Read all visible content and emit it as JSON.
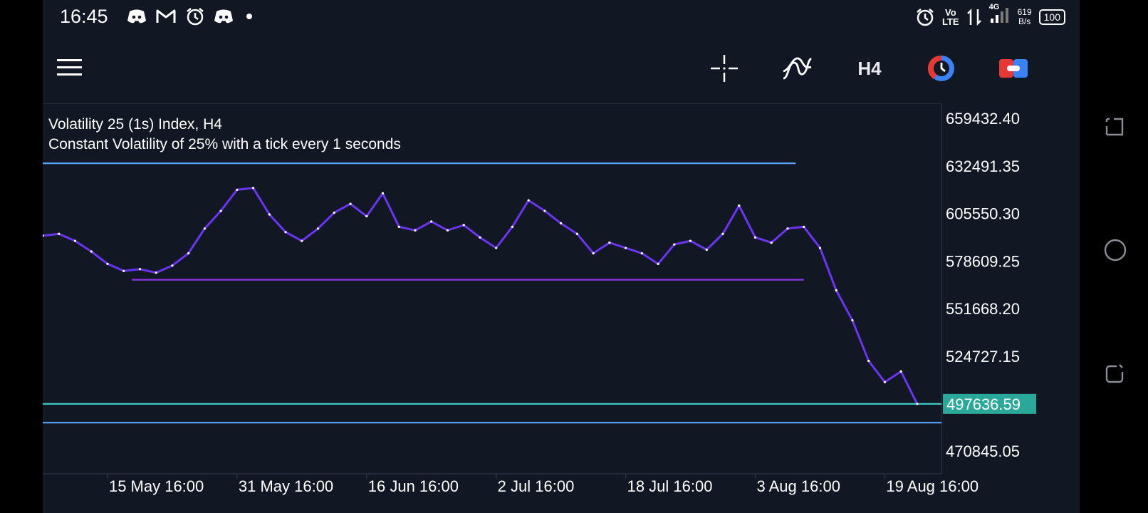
{
  "status": {
    "time": "16:45",
    "left_icons": [
      "discord-icon",
      "gmail-icon",
      "alarm-icon",
      "discord-icon",
      "notification-dot-icon"
    ],
    "right_icons": [
      "alarm-icon",
      "volte-icon",
      "data-arrows-icon",
      "signal-icon"
    ],
    "volte": "Vo\nLTE",
    "network": "4G",
    "data_rate": "619\nB/s",
    "battery": "100"
  },
  "toolbar": {
    "menu_icon": "hamburger-menu-icon",
    "crosshair_icon": "crosshair-icon",
    "indicators_icon": "indicators-icon",
    "timeframe": "H4",
    "clock_icon": "chart-clock-icon",
    "toggle_icon": "trade-toggle-icon"
  },
  "chart": {
    "title": "Volatility 25 (1s) Index, H4",
    "subtitle": "Constant Volatility of 25% with a tick every 1 seconds",
    "current_price": "497636.59"
  },
  "colors": {
    "background": "#111824",
    "price_line": "#6b34f0",
    "hline_blue": "#5aa6ff",
    "hline_purple": "#8a35e8",
    "hline_cyan": "#3fc7c0",
    "price_badge": "#2aa89a"
  },
  "chart_data": {
    "type": "line",
    "series_color": "#6b34f0",
    "x": [
      "15 May 16:00",
      "31 May 16:00",
      "16 Jun 16:00",
      "2 Jul 16:00",
      "18 Jul 16:00",
      "3 Aug 16:00",
      "19 Aug 16:00"
    ],
    "y_ticks": [
      "659432.40",
      "632491.35",
      "605550.30",
      "578609.25",
      "551668.20",
      "524727.15",
      "497636.59",
      "470845.05"
    ],
    "y_tick_values": [
      659432.4,
      632491.35,
      605550.3,
      578609.25,
      551668.2,
      524727.15,
      497636.59,
      470845.05
    ],
    "ylim": [
      458000,
      668000
    ],
    "xlim": [
      "2023-05-07",
      "2023-08-26"
    ],
    "series": [
      {
        "x": [
          "2023-05-07",
          "2023-05-09",
          "2023-05-11",
          "2023-05-13",
          "2023-05-15",
          "2023-05-17",
          "2023-05-19",
          "2023-05-21",
          "2023-05-23",
          "2023-05-25",
          "2023-05-27",
          "2023-05-29",
          "2023-05-31",
          "2023-06-02",
          "2023-06-04",
          "2023-06-06",
          "2023-06-08",
          "2023-06-10",
          "2023-06-12",
          "2023-06-14",
          "2023-06-16",
          "2023-06-18",
          "2023-06-20",
          "2023-06-22",
          "2023-06-24",
          "2023-06-26",
          "2023-06-28",
          "2023-06-30",
          "2023-07-02",
          "2023-07-04",
          "2023-07-06",
          "2023-07-08",
          "2023-07-10",
          "2023-07-12",
          "2023-07-14",
          "2023-07-16",
          "2023-07-18",
          "2023-07-20",
          "2023-07-22",
          "2023-07-24",
          "2023-07-26",
          "2023-07-28",
          "2023-07-30",
          "2023-08-01",
          "2023-08-03",
          "2023-08-05",
          "2023-08-07",
          "2023-08-09",
          "2023-08-11",
          "2023-08-13",
          "2023-08-15",
          "2023-08-17",
          "2023-08-19",
          "2023-08-21"
        ],
        "y": [
          593000,
          594000,
          590000,
          584000,
          577000,
          573000,
          574000,
          572000,
          576000,
          583000,
          597000,
          607000,
          619000,
          620000,
          605000,
          595000,
          590000,
          597000,
          606000,
          611000,
          604000,
          617000,
          598000,
          596000,
          601000,
          596000,
          599000,
          592000,
          586000,
          598000,
          613000,
          607000,
          600000,
          594000,
          583000,
          589000,
          586000,
          583000,
          577000,
          588000,
          590000,
          585000,
          594000,
          610000,
          592000,
          589000,
          597000,
          598000,
          586000,
          562000,
          545000,
          522000,
          510000,
          516000
        ]
      },
      {
        "x": [
          "2023-08-21",
          "2023-08-23"
        ],
        "y": [
          516000,
          497636.59
        ]
      }
    ],
    "horizontal_lines": [
      {
        "y": 634000,
        "x_start": "2023-05-07",
        "x_end": "2023-08-08",
        "color": "#5aa6ff"
      },
      {
        "y": 568000,
        "x_start": "2023-05-18",
        "x_end": "2023-08-09",
        "color": "#8a35e8"
      },
      {
        "y": 497636.59,
        "x_start": "2023-05-07",
        "x_end": "2023-08-26",
        "color": "#3fc7c0"
      },
      {
        "y": 487000,
        "x_start": "2023-05-07",
        "x_end": "2023-08-26",
        "color": "#5aa6ff"
      }
    ]
  },
  "system_nav": {
    "recent_icon": "recent-apps-icon",
    "home_icon": "home-circle-icon",
    "back_icon": "back-icon"
  }
}
